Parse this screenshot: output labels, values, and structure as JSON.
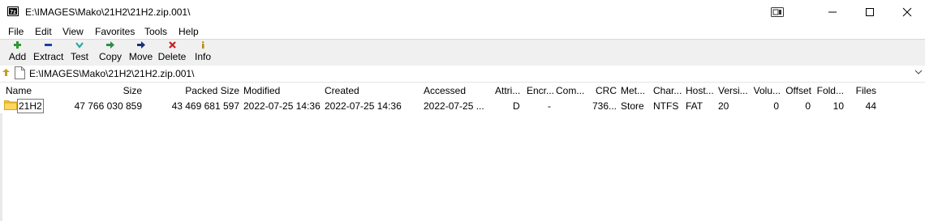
{
  "window": {
    "title": "E:\\IMAGES\\Mako\\21H2\\21H2.zip.001\\"
  },
  "menu": [
    "File",
    "Edit",
    "View",
    "Favorites",
    "Tools",
    "Help"
  ],
  "toolbar": {
    "add": "Add",
    "extract": "Extract",
    "test": "Test",
    "copy": "Copy",
    "move": "Move",
    "delete": "Delete",
    "info": "Info"
  },
  "address": {
    "path": "E:\\IMAGES\\Mako\\21H2\\21H2.zip.001\\"
  },
  "columns": {
    "name": "Name",
    "size": "Size",
    "packed_size": "Packed Size",
    "modified": "Modified",
    "created": "Created",
    "accessed": "Accessed",
    "attributes": "Attri...",
    "encrypted": "Encr...",
    "comment": "Com...",
    "crc": "CRC",
    "method": "Met...",
    "characteristics": "Char...",
    "host_os": "Host...",
    "version": "Versi...",
    "volume": "Volu...",
    "offset": "Offset",
    "folders": "Fold...",
    "files": "Files"
  },
  "rows": [
    {
      "name": "21H2",
      "size": "47 766 030 859",
      "packed_size": "43 469 681 597",
      "modified": "2022-07-25 14:36",
      "created": "2022-07-25 14:36",
      "accessed": "2022-07-25 ...",
      "attributes": "D",
      "encrypted": "-",
      "comment": "",
      "crc": "736...",
      "method": "Store",
      "characteristics": "NTFS",
      "host_os": "FAT",
      "version": "20",
      "volume": "0",
      "offset": "0",
      "folders": "10",
      "files": "44"
    }
  ]
}
